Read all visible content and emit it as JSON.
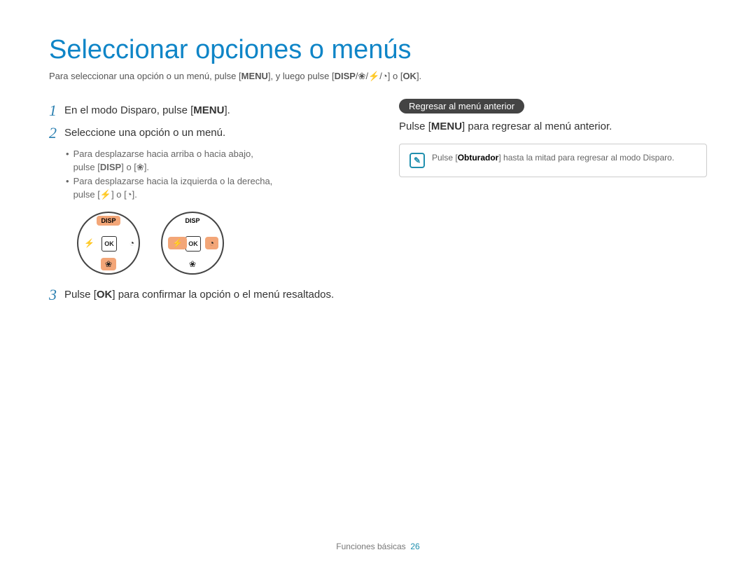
{
  "title": "Seleccionar opciones o menús",
  "intro": {
    "a": "Para seleccionar una opción o un menú, pulse [",
    "menu": "MENU",
    "b": "], y luego pulse [",
    "disp": "DISP",
    "c": "/",
    "d": "/",
    "e": "/",
    "f": "] o [",
    "ok": "OK",
    "g": "]."
  },
  "steps": {
    "s1": {
      "n": "1",
      "a": "En el modo Disparo, pulse [",
      "menu": "MENU",
      "b": "]."
    },
    "s2": {
      "n": "2",
      "a": "Seleccione una opción o un menú."
    },
    "sub1": {
      "a": "Para desplazarse hacia arriba o hacia abajo,",
      "b": "pulse [",
      "disp": "DISP",
      "c": "] o ["
    },
    "sub2": {
      "a": "Para desplazarse hacia la izquierda o la derecha,",
      "b": "pulse [",
      "c": "] o ["
    },
    "s3": {
      "n": "3",
      "a": "Pulse [",
      "ok": "OK",
      "b": "] para confirmar la opción o el menú resaltados."
    }
  },
  "wheel": {
    "disp": "DISP",
    "ok": "OK"
  },
  "right": {
    "pill": "Regresar al menú anterior",
    "text": {
      "a": "Pulse [",
      "menu": "MENU",
      "b": "] para regresar al menú anterior."
    },
    "note": {
      "a": "Pulse [",
      "btn": "Obturador",
      "b": "] hasta la mitad para regresar al modo Disparo."
    }
  },
  "footer": {
    "section": "Funciones básicas",
    "page": "26"
  }
}
